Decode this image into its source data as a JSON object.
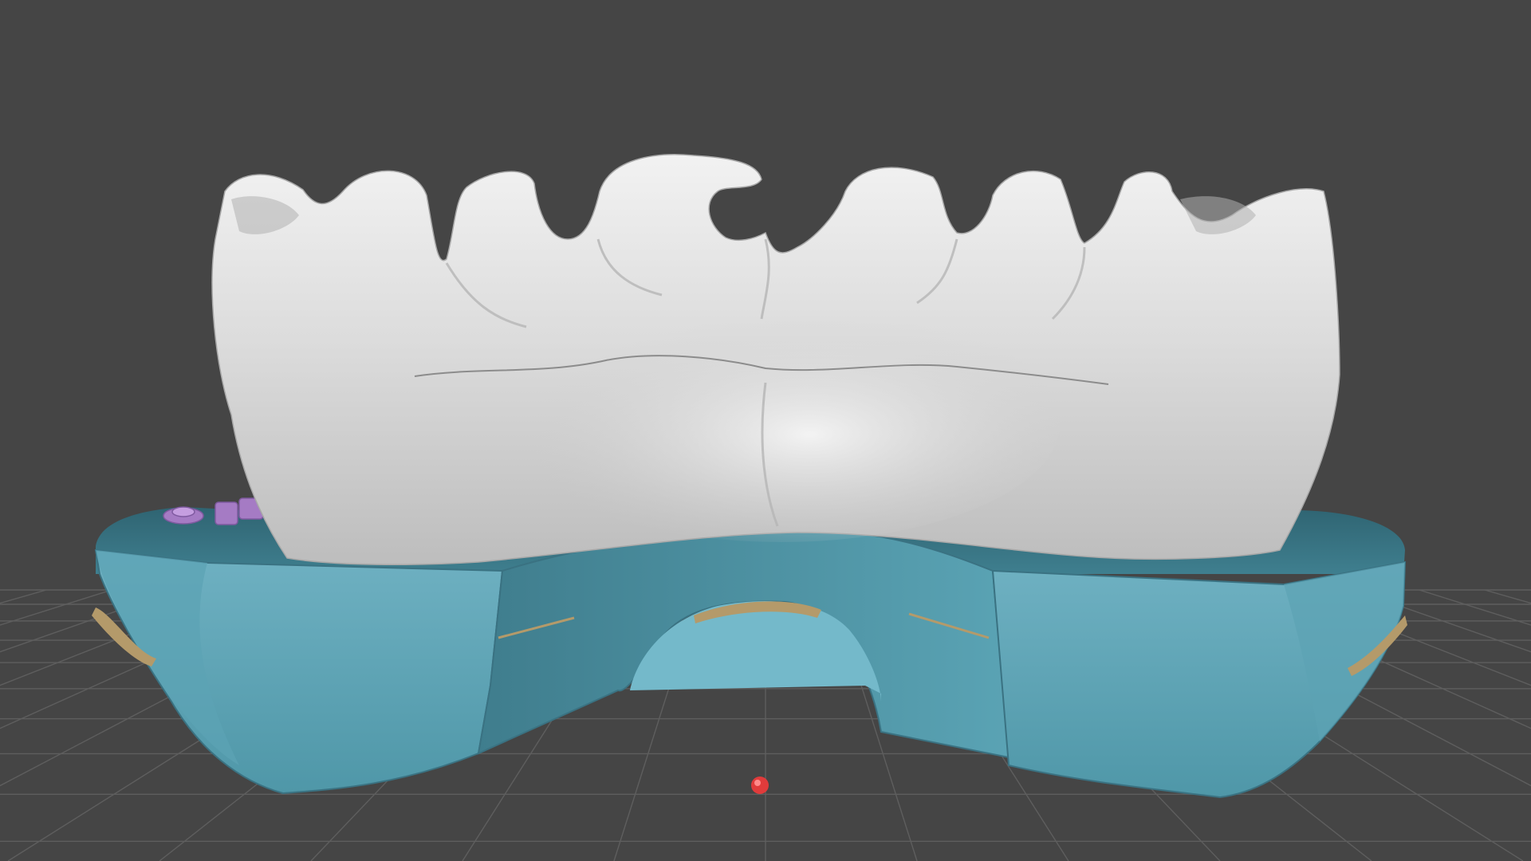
{
  "viewport": {
    "background_color": "#454545",
    "grid_visible": true,
    "grid_color": "#5e5e5e"
  },
  "scene": {
    "models": [
      {
        "name": "lower-arch-model",
        "color": "#cfcfcf"
      },
      {
        "name": "model-base",
        "color": "#4f97a8"
      },
      {
        "name": "base-pins",
        "color": "#b49a6a"
      },
      {
        "name": "base-label",
        "color": "#a57bc4"
      }
    ],
    "origin_marker_color": "#e03b3b"
  }
}
